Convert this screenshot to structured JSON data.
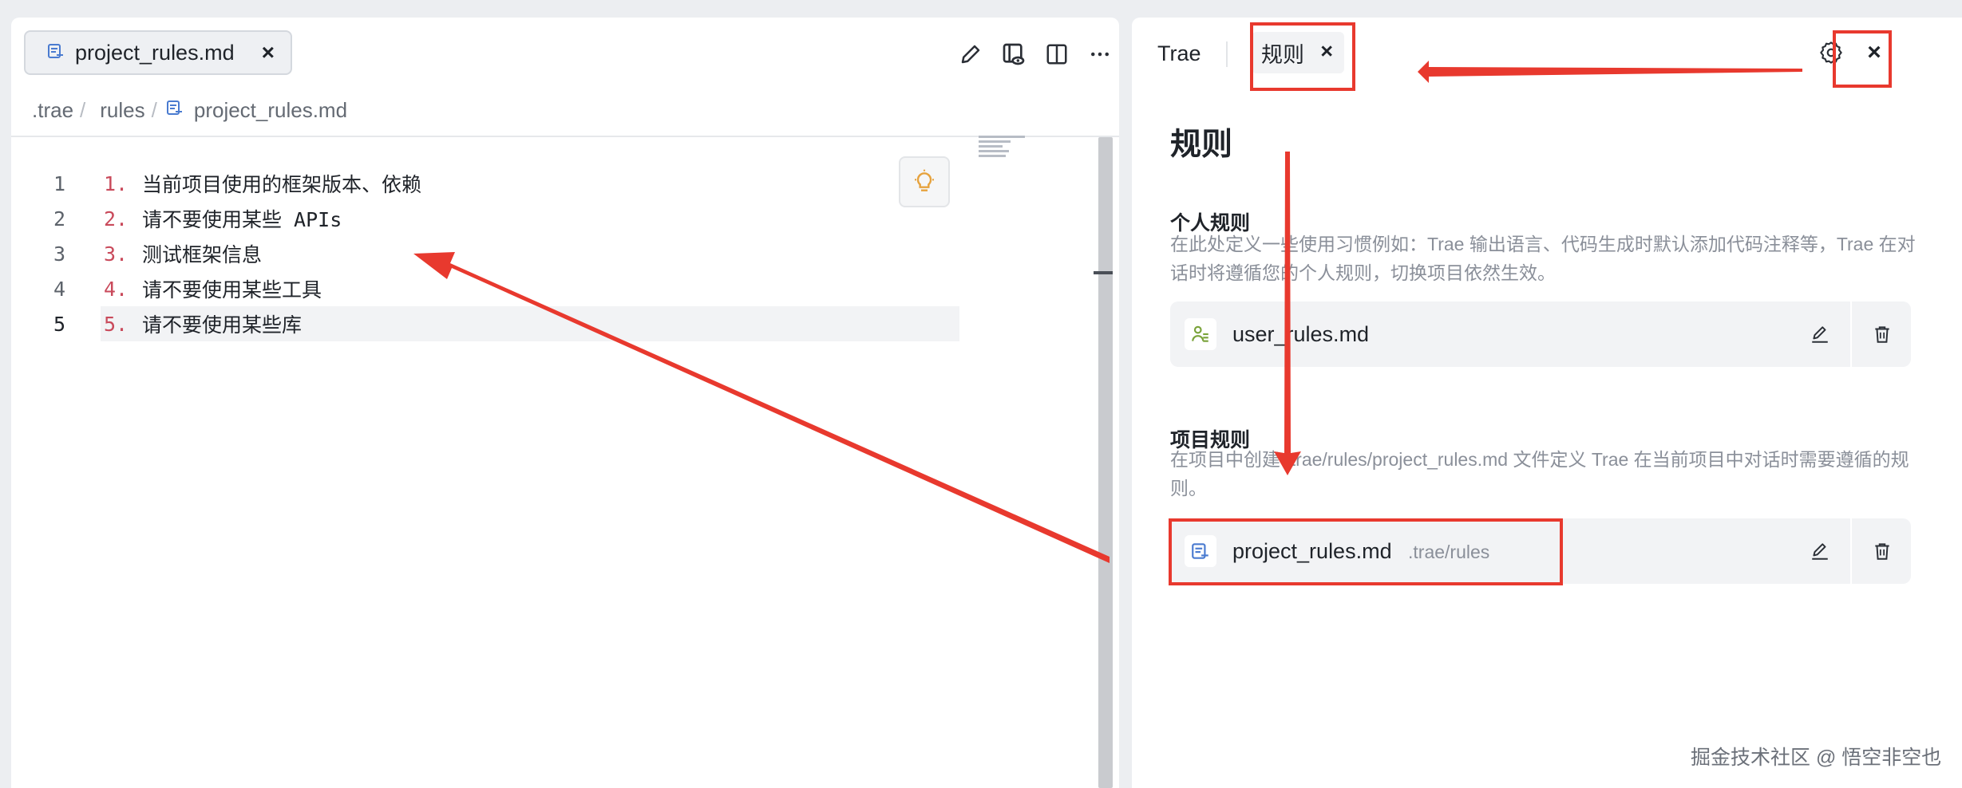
{
  "editor": {
    "tab": {
      "label": "project_rules.md",
      "close": "×"
    },
    "toolbar": [
      "edit-icon",
      "preview-icon",
      "split-icon",
      "more-icon"
    ],
    "breadcrumb": [
      ".trae",
      "rules",
      "project_rules.md"
    ],
    "breadcrumb_sep": "/",
    "lines": [
      {
        "no": "1",
        "mark": "1.",
        "text": "当前项目使用的框架版本、依赖"
      },
      {
        "no": "2",
        "mark": "2.",
        "text": "请不要使用某些 APIs"
      },
      {
        "no": "3",
        "mark": "3.",
        "text": "测试框架信息"
      },
      {
        "no": "4",
        "mark": "4.",
        "text": "请不要使用某些工具"
      },
      {
        "no": "5",
        "mark": "5.",
        "text": "请不要使用某些库"
      }
    ],
    "active_line": 5
  },
  "panel": {
    "tab_trae": "Trae",
    "tab_rules": "规则",
    "tab_close": "×",
    "close": "×",
    "title": "规则",
    "personal": {
      "title": "个人规则",
      "desc": "在此处定义一些使用习惯例如：Trae 输出语言、代码生成时默认添加代码注释等，Trae 在对话时将遵循您的个人规则，切换项目依然生效。",
      "file": "user_rules.md"
    },
    "project": {
      "title": "项目规则",
      "desc": "在项目中创建 .trae/rules/project_rules.md 文件定义 Trae 在当前项目中对话时需要遵循的规则。",
      "file": "project_rules.md",
      "path": ".trae/rules"
    }
  },
  "watermark": "掘金技术社区 @ 悟空非空也",
  "colors": {
    "annotation": "#e8392e",
    "list_marker": "#c94a5b",
    "file_icon": "#4a7bd0",
    "user_icon": "#7aa33a"
  }
}
